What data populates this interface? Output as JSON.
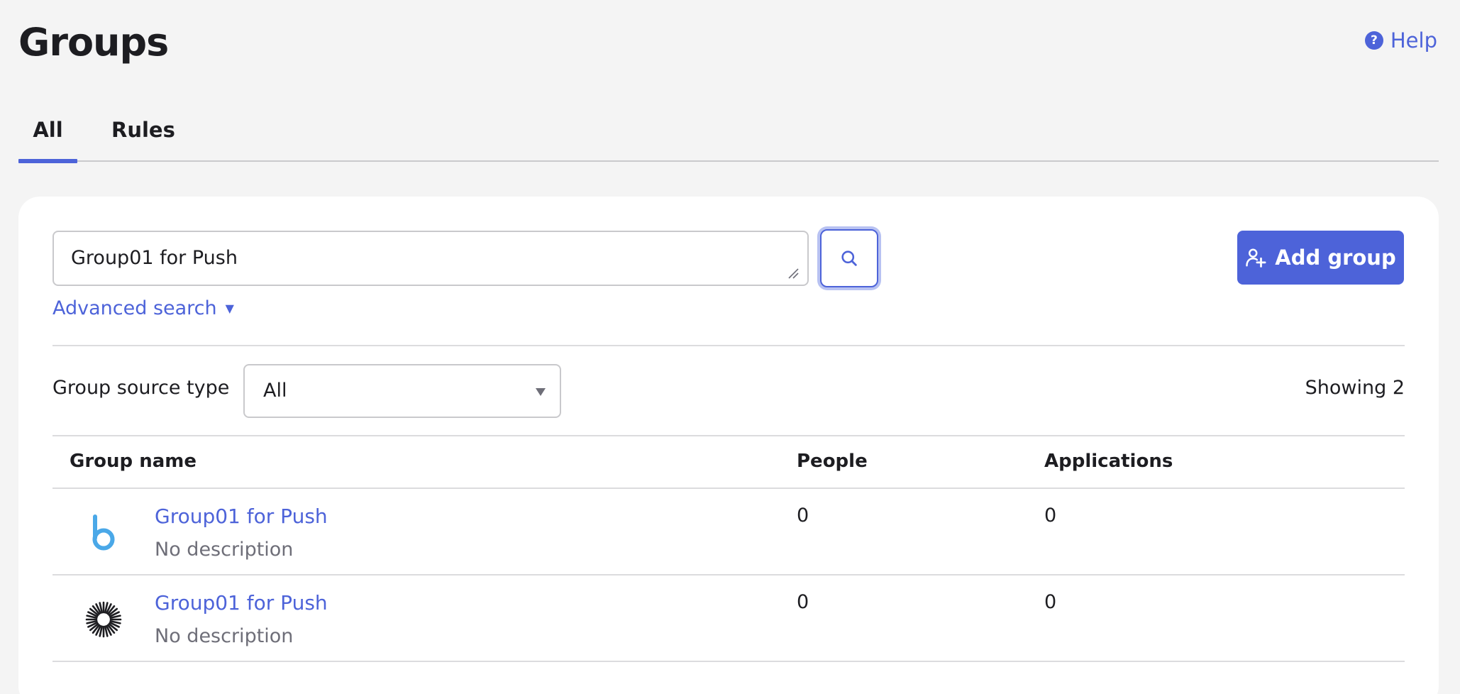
{
  "header": {
    "title": "Groups",
    "help_label": "Help",
    "help_icon": "question-circle-icon"
  },
  "tabs": [
    {
      "label": "All",
      "active": true
    },
    {
      "label": "Rules",
      "active": false
    }
  ],
  "search": {
    "value": "Group01 for Push",
    "button_icon": "search-icon",
    "advanced_label": "Advanced search",
    "advanced_caret": "▼"
  },
  "toolbar": {
    "add_group_label": "Add group",
    "add_group_icon": "add-person-icon"
  },
  "filter": {
    "label": "Group source type",
    "selected": "All",
    "showing": "Showing 2"
  },
  "table": {
    "columns": [
      "Group name",
      "People",
      "Applications"
    ],
    "rows": [
      {
        "logo": "b-app-logo-icon",
        "name": "Group01 for Push",
        "description": "No description",
        "people": "0",
        "applications": "0"
      },
      {
        "logo": "sunburst-logo-icon",
        "name": "Group01 for Push",
        "description": "No description",
        "people": "0",
        "applications": "0"
      }
    ]
  },
  "colors": {
    "accent": "#4d63d9",
    "background": "#f4f4f4",
    "card": "#ffffff",
    "muted_text": "#6e6e78"
  }
}
